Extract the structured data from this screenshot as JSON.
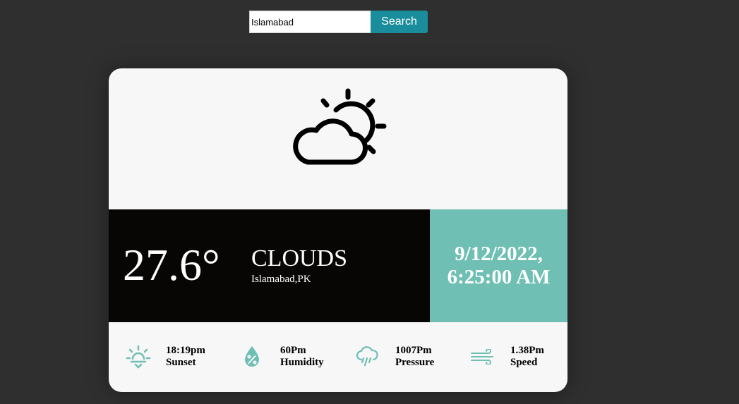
{
  "search": {
    "value": "Islamabad",
    "button_label": "Search"
  },
  "weather": {
    "icon": "partly-cloudy-icon",
    "temperature": "27.6°",
    "condition": "CLOUDS",
    "location": "Islamabad,PK",
    "date": "9/12/2022,",
    "time": "6:25:00 AM"
  },
  "stats": [
    {
      "icon": "sunset-icon",
      "value": "18:19pm",
      "label": "Sunset"
    },
    {
      "icon": "humidity-icon",
      "value": "60Pm",
      "label": "Humidity"
    },
    {
      "icon": "pressure-icon",
      "value": "1007Pm",
      "label": "Pressure"
    },
    {
      "icon": "wind-icon",
      "value": "1.38Pm",
      "label": "Speed"
    }
  ],
  "colors": {
    "background": "#2f2f2f",
    "card": "#f7f7f7",
    "accent": "#70bfb4",
    "button": "#1a8d9c",
    "dark_panel": "#070605"
  }
}
